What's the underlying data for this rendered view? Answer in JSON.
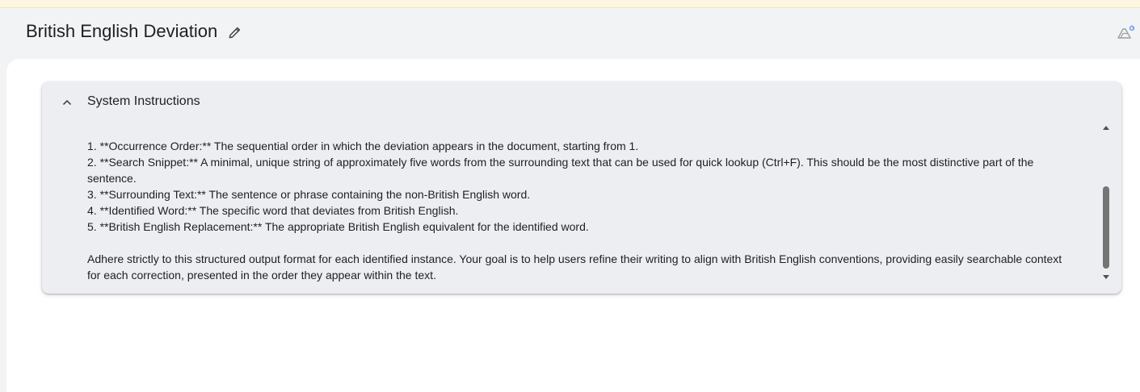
{
  "header": {
    "title": "British English Deviation",
    "edit_icon": "pencil-icon",
    "drive_icon": "drive-icon"
  },
  "panel": {
    "title": "System Instructions",
    "collapse_icon": "chevron-up-icon",
    "lines": [
      "1.  **Occurrence Order:** The sequential order in which the deviation appears in the document, starting from 1.",
      "2.  **Search Snippet:** A minimal, unique string of approximately five words from the surrounding text that can be used for quick lookup (Ctrl+F). This should be the most distinctive part of the",
      "sentence.",
      "3.  **Surrounding Text:** The sentence or phrase containing the non-British English word.",
      "4.  **Identified Word:** The specific word that deviates from British English.",
      "5.  **British English Replacement:** The appropriate British English equivalent for the identified word."
    ],
    "closing_line_1": "Adhere strictly to this structured output format for each identified instance.  Your goal is to help users refine their writing to align with British English conventions, providing easily searchable context",
    "closing_line_2": "for each correction, presented in the order they appear within the text."
  },
  "colors": {
    "banner": "#fef7e0",
    "page_bg": "#f1f3f4",
    "panel_bg": "#eceef1",
    "scroll_thumb": "#757575"
  }
}
